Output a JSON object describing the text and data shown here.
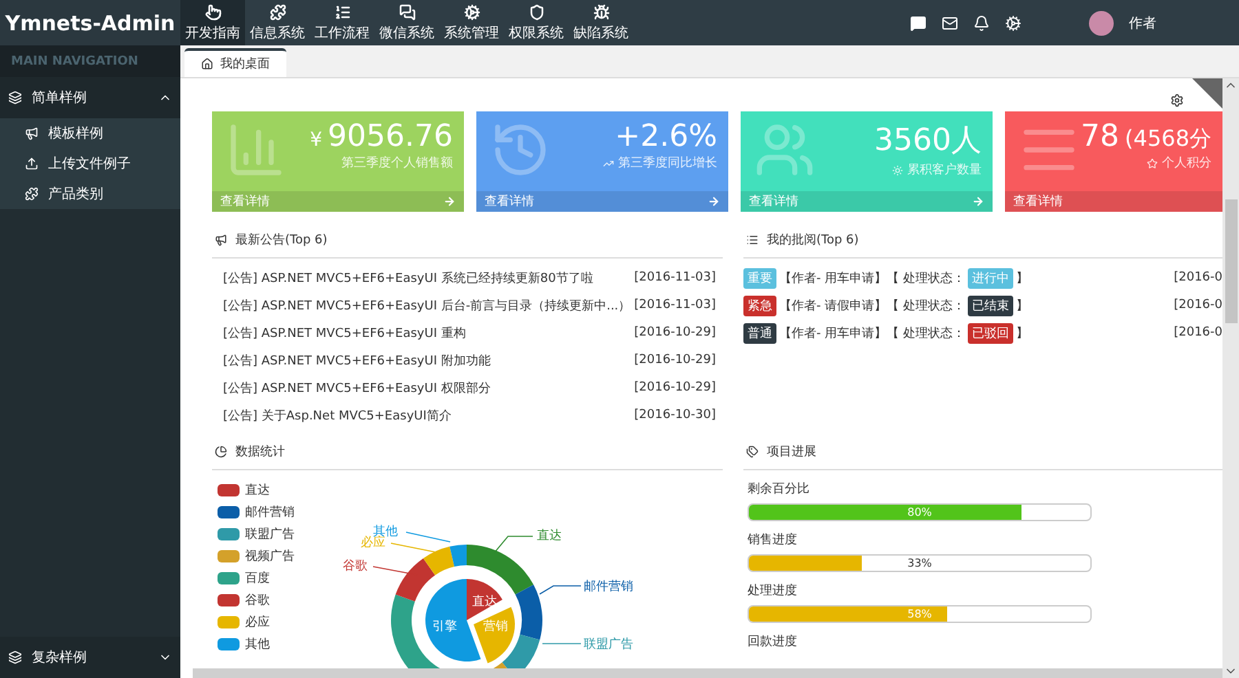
{
  "brand": "Ymnets-Admin",
  "top_menu": [
    {
      "label": "开发指南",
      "selected": true
    },
    {
      "label": "信息系统",
      "selected": false
    },
    {
      "label": "工作流程",
      "selected": false
    },
    {
      "label": "微信系统",
      "selected": false
    },
    {
      "label": "系统管理",
      "selected": false
    },
    {
      "label": "权限系统",
      "selected": false
    },
    {
      "label": "缺陷系统",
      "selected": false
    }
  ],
  "user": {
    "name": "作者"
  },
  "sidebar": {
    "header": "MAIN NAVIGATION",
    "groups": [
      {
        "label": "简单样例",
        "expanded": true,
        "children": [
          {
            "label": "模板样例"
          },
          {
            "label": "上传文件例子"
          },
          {
            "label": "产品类别"
          }
        ]
      },
      {
        "label": "复杂样例",
        "expanded": false
      }
    ]
  },
  "tabs": [
    {
      "label": "我的桌面",
      "selected": true
    }
  ],
  "stat_cards": [
    {
      "kind": "chart",
      "color": "#9dd35f",
      "prefix": "¥",
      "value": "9056.76",
      "subtitle": "第三季度个人销售额",
      "footer": "查看详情"
    },
    {
      "kind": "history",
      "color": "#5d9ff0",
      "value": "+2.6%",
      "subtitle": "第三季度同比增长",
      "footer": "查看详情"
    },
    {
      "kind": "users",
      "color": "#42e0bc",
      "value": "3560人",
      "subtitle": "累积客户数量",
      "footer": "查看详情"
    },
    {
      "kind": "list",
      "color": "#f85a5d",
      "value": "78",
      "extra": "(4568分",
      "subtitle": "个人积分",
      "footer": "查看详情"
    }
  ],
  "notices": {
    "title": "最新公告(Top 6)",
    "items": [
      {
        "text": "[公告] ASP.NET MVC5+EF6+EasyUI 系统已经持续更新80节了啦",
        "date": "[2016-11-03]"
      },
      {
        "text": "[公告] ASP.NET MVC5+EF6+EasyUI 后台-前言与目录（持续更新中...）",
        "date": "[2016-11-03]"
      },
      {
        "text": "[公告] ASP.NET MVC5+EF6+EasyUI 重构",
        "date": "[2016-10-29]"
      },
      {
        "text": "[公告] ASP.NET MVC5+EF6+EasyUI 附加功能",
        "date": "[2016-10-29]"
      },
      {
        "text": "[公告] ASP.NET MVC5+EF6+EasyUI 权限部分",
        "date": "[2016-10-29]"
      },
      {
        "text": "[公告] 关于Asp.Net MVC5+EasyUI简介",
        "date": "[2016-10-30]"
      }
    ]
  },
  "approvals": {
    "title": "我的批阅(Top 6)",
    "items": [
      {
        "priority": {
          "label": "重要",
          "color": "#5bc0de"
        },
        "request": "【作者- 用车申请】",
        "status_prefix": "【 处理状态：",
        "status": {
          "label": "进行中",
          "color": "#5bc0de"
        },
        "status_suffix": "】",
        "date": "[2016-0"
      },
      {
        "priority": {
          "label": "紧急",
          "color": "#c9302c"
        },
        "request": "【作者- 请假申请】",
        "status_prefix": "【 处理状态：",
        "status": {
          "label": "已结束",
          "color": "#2f3b43"
        },
        "status_suffix": "】",
        "date": "[2016-0"
      },
      {
        "priority": {
          "label": "普通",
          "color": "#2f3b43"
        },
        "request": "【作者- 用车申请】",
        "status_prefix": "【 处理状态：",
        "status": {
          "label": "已驳回",
          "color": "#c9302c"
        },
        "status_suffix": "】",
        "date": "[2016-0"
      }
    ]
  },
  "stats": {
    "title": "数据统计",
    "legend": [
      {
        "label": "直达",
        "color": "#c23531"
      },
      {
        "label": "邮件营销",
        "color": "#0b5ea8"
      },
      {
        "label": "联盟广告",
        "color": "#2f9aa8"
      },
      {
        "label": "视频广告",
        "color": "#d4a12a"
      },
      {
        "label": "百度",
        "color": "#2ea38a"
      },
      {
        "label": "谷歌",
        "color": "#c23531"
      },
      {
        "label": "必应",
        "color": "#e6b600"
      },
      {
        "label": "其他",
        "color": "#0f9ae0"
      }
    ],
    "outer_labels": [
      {
        "label": "其他",
        "color": "#0f9ae0"
      },
      {
        "label": "必应",
        "color": "#e6b600"
      },
      {
        "label": "谷歌",
        "color": "#c23531"
      },
      {
        "label": "直达",
        "color": "#2e8b2e"
      },
      {
        "label": "邮件营销",
        "color": "#0b5ea8"
      },
      {
        "label": "联盟广告",
        "color": "#2f9aa8"
      }
    ],
    "inner_labels": [
      "直达",
      "营销",
      "引擎"
    ]
  },
  "progress": {
    "title": "项目进展",
    "items": [
      {
        "label": "剩余百分比",
        "level": 0.8,
        "reading": "80%",
        "color": "#52c41a"
      },
      {
        "label": "销售进度",
        "level": 0.33,
        "reading": "33%",
        "color": "#e6b600"
      },
      {
        "label": "处理进度",
        "level": 0.58,
        "reading": "58%",
        "color": "#e6b600"
      },
      {
        "label": "回款进度"
      }
    ]
  }
}
